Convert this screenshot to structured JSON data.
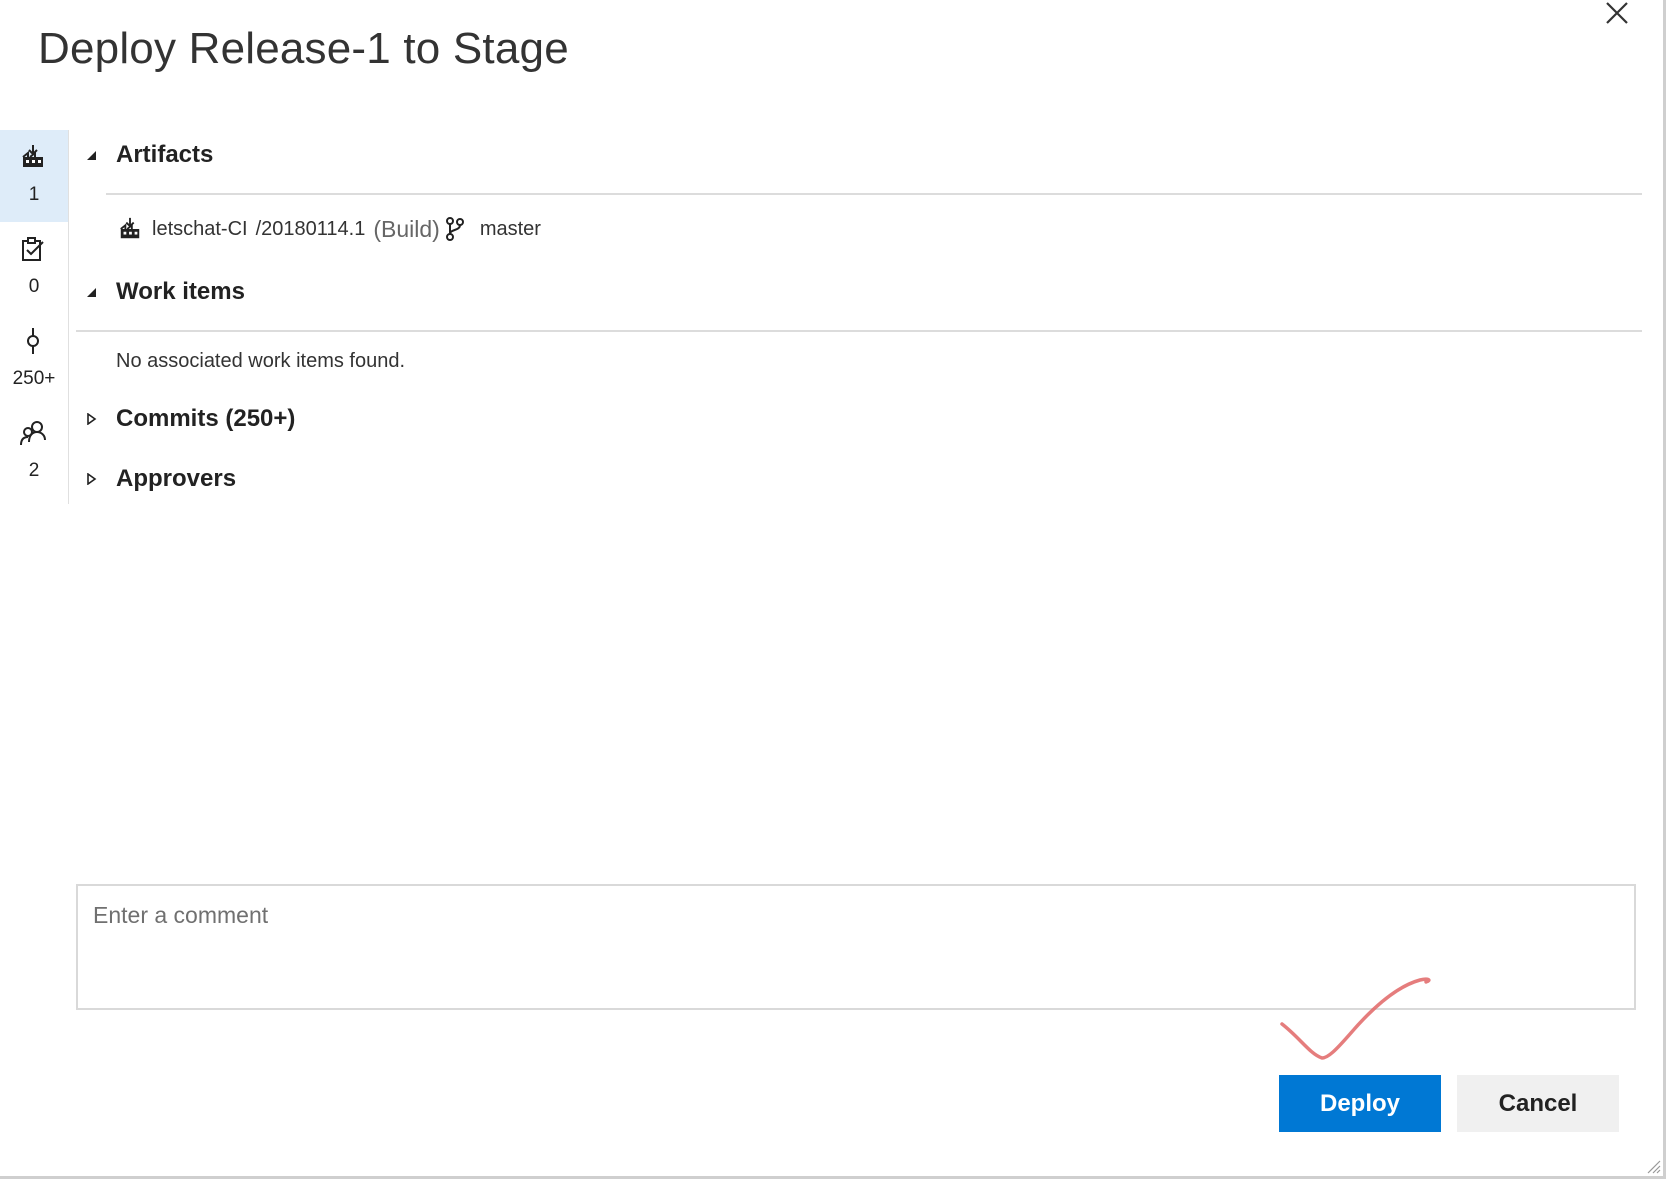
{
  "dialog": {
    "title": "Deploy Release-1 to Stage",
    "close_icon": "close-icon"
  },
  "rail": {
    "items": [
      {
        "icon": "build-artifact-icon",
        "count": "1",
        "active": true
      },
      {
        "icon": "work-item-icon",
        "count": "0",
        "active": false
      },
      {
        "icon": "commit-icon",
        "count": "250+",
        "active": false
      },
      {
        "icon": "approvers-icon",
        "count": "2",
        "active": false
      }
    ]
  },
  "sections": {
    "artifacts": {
      "title": "Artifacts",
      "expanded": true,
      "item": {
        "icon": "build-artifact-icon",
        "name": "letschat-CI",
        "version": "/20180114.1",
        "type": "(Build)",
        "branch_icon": "branch-icon",
        "branch": "master"
      }
    },
    "work_items": {
      "title": "Work items",
      "expanded": true,
      "empty_message": "No associated work items found."
    },
    "commits": {
      "title": "Commits (250+)",
      "expanded": false
    },
    "approvers": {
      "title": "Approvers",
      "expanded": false
    }
  },
  "comment": {
    "placeholder": "Enter a comment",
    "value": ""
  },
  "buttons": {
    "deploy": "Deploy",
    "cancel": "Cancel"
  },
  "colors": {
    "primary": "#0078d4",
    "rail_active": "#deecf9",
    "annotation": "#e06666"
  }
}
